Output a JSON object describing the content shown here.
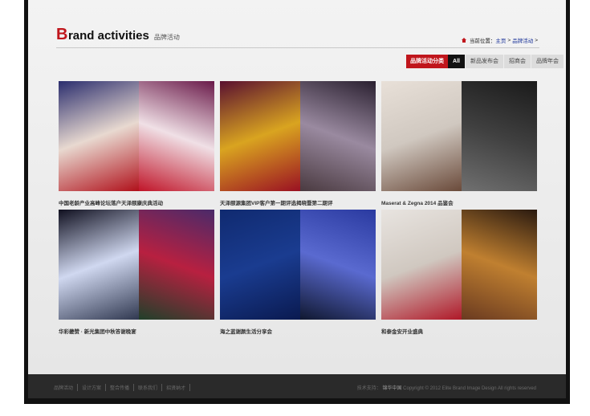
{
  "header": {
    "brand_first": "B",
    "brand_rest": "rand activities",
    "brand_cn": "品牌活动",
    "breadcrumb": {
      "prefix": "当前位置：",
      "home": "主页",
      "sep": ">",
      "current": "品牌活动"
    }
  },
  "tabs": {
    "head": "品牌活动分类",
    "items": [
      "All",
      "新品发布会",
      "招商会",
      "品牌年会"
    ]
  },
  "items": [
    {
      "caption": "中国老龄产业高峰论坛落户天泽颐康庆典活动",
      "left": [
        "#2b2e6e",
        "#e8d9d0",
        "#b0101a"
      ],
      "right": [
        "#6a1a4a",
        "#f0e0e6",
        "#c01428"
      ]
    },
    {
      "caption": "天泽颐源集团VIP客户第一期评选揭晓暨第二期评",
      "left": [
        "#5a1030",
        "#d9a420",
        "#9a1022"
      ],
      "right": [
        "#2a2030",
        "#9a8aa0",
        "#4a3a40"
      ]
    },
    {
      "caption": "Maserat & Zegna 2014 品鉴会",
      "left": [
        "#e8e0d8",
        "#d0c8c0",
        "#6a4a3a"
      ],
      "right": [
        "#1a1a1a",
        "#404040",
        "#707070"
      ]
    },
    {
      "caption": "华彩畿赞 · 新光集团中秋答谢晚宴",
      "left": [
        "#101020",
        "#d0d8f0",
        "#303850"
      ],
      "right": [
        "#4a2a6a",
        "#b82040",
        "#20402a"
      ]
    },
    {
      "caption": "海之蓝谢颜生活分享会",
      "left": [
        "#102a70",
        "#1a3c90",
        "#0a1a50"
      ],
      "right": [
        "#2a3aa0",
        "#5a6ad0",
        "#101830"
      ]
    },
    {
      "caption": "和泰金安开业盛典",
      "left": [
        "#e8e4e0",
        "#d0c8c0",
        "#b01828"
      ],
      "right": [
        "#2a1a10",
        "#c08030",
        "#6a3a20"
      ]
    }
  ],
  "footer": {
    "links": [
      "品牌活动",
      "设计方案",
      "整合传播",
      "联系我们",
      "招贤纳才"
    ],
    "design_label": "技术支持：",
    "design_name": "锦华中国",
    "copyright": "Copyright © 2012 Elite Brand Image Design All rights reserved"
  }
}
